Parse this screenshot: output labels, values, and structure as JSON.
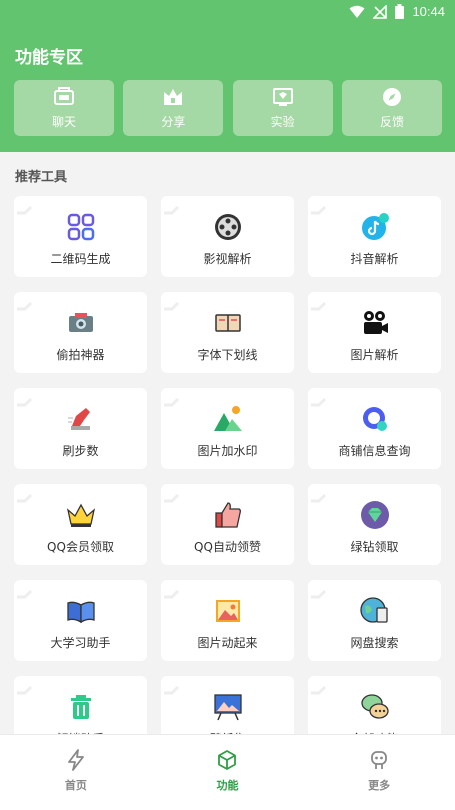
{
  "status_bar": {
    "time": "10:44"
  },
  "header": {
    "title": "功能专区"
  },
  "quick_actions": [
    {
      "label": "聊天",
      "icon": "chat-icon"
    },
    {
      "label": "分享",
      "icon": "share-icon"
    },
    {
      "label": "实验",
      "icon": "experiment-icon"
    },
    {
      "label": "反馈",
      "icon": "compass-icon"
    }
  ],
  "section": {
    "title": "推荐工具"
  },
  "tools": [
    {
      "label": "二维码生成",
      "icon": "qr-code-icon"
    },
    {
      "label": "影视解析",
      "icon": "film-reel-icon"
    },
    {
      "label": "抖音解析",
      "icon": "tiktok-icon"
    },
    {
      "label": "偷拍神器",
      "icon": "camera-icon"
    },
    {
      "label": "字体下划线",
      "icon": "book-icon"
    },
    {
      "label": "图片解析",
      "icon": "video-camera-icon"
    },
    {
      "label": "刷步数",
      "icon": "running-shoe-icon"
    },
    {
      "label": "图片加水印",
      "icon": "mountain-image-icon"
    },
    {
      "label": "商铺信息查询",
      "icon": "search-bubble-icon"
    },
    {
      "label": "QQ会员领取",
      "icon": "crown-icon"
    },
    {
      "label": "QQ自动领赞",
      "icon": "thumbs-up-icon"
    },
    {
      "label": "绿钻领取",
      "icon": "diamond-icon"
    },
    {
      "label": "大学习助手",
      "icon": "open-book-icon"
    },
    {
      "label": "图片动起来",
      "icon": "picture-frame-icon"
    },
    {
      "label": "网盘搜索",
      "icon": "globe-doc-icon"
    },
    {
      "label": "解锁助手",
      "icon": "trash-icon"
    },
    {
      "label": "壁纸集",
      "icon": "easel-icon"
    },
    {
      "label": "全部功能",
      "icon": "chat-bubbles-icon"
    }
  ],
  "bottom_nav": [
    {
      "label": "首页",
      "icon": "lightning-icon"
    },
    {
      "label": "功能",
      "icon": "cube-icon"
    },
    {
      "label": "更多",
      "icon": "robot-icon"
    }
  ],
  "colors": {
    "brand_green": "#63c46f",
    "active_green": "#2e9e45"
  }
}
